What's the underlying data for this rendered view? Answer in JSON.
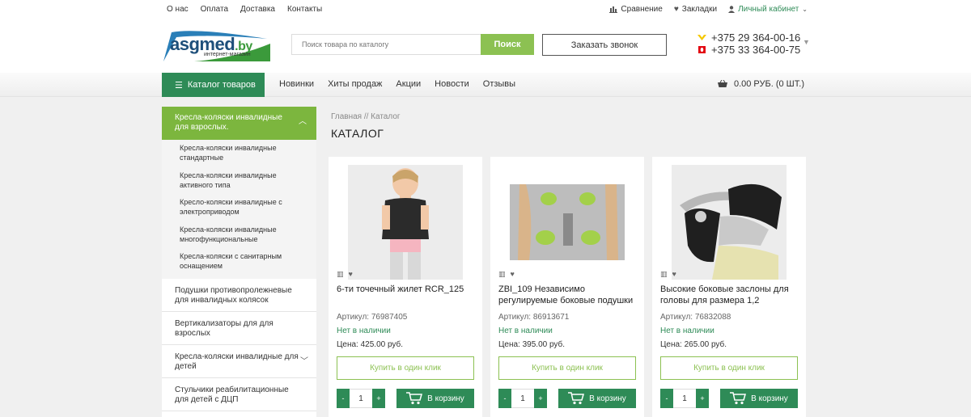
{
  "topbar": {
    "links": [
      "О нас",
      "Оплата",
      "Доставка",
      "Контакты"
    ],
    "compare": "Сравнение",
    "bookmarks": "Закладки",
    "account": "Личный кабинет"
  },
  "logo": {
    "brand": "asgmed",
    "domain": ".by",
    "tagline": "интернет-магазин"
  },
  "search": {
    "placeholder": "Поиск товара по каталогу",
    "button": "Поиск"
  },
  "call_button": "Заказать звонок",
  "phones": [
    "+375 29 364-00-16",
    "+375 33 364-00-75"
  ],
  "nav": {
    "catalog": "Каталог товаров",
    "links": [
      "Новинки",
      "Хиты продаж",
      "Акции",
      "Новости",
      "Отзывы"
    ],
    "cart": "0.00 РУБ. (0 ШТ.)"
  },
  "sidebar": {
    "active": "Кресла-коляски инвалидные для взрослых.",
    "subitems": [
      "Кресла-коляски инвалидные стандартные",
      "Кресла-коляски инвалидные активного типа",
      "Кресло-коляски инвалидные с электроприводом",
      "Кресла-коляски инвалидные многофункциональные",
      "Кресла-коляски с санитарным оснащением"
    ],
    "items": [
      {
        "label": "Подушки противопролежневые для инвалидных колясок",
        "chevron": false
      },
      {
        "label": "Вертикализаторы для для взрослых",
        "chevron": false
      },
      {
        "label": "Кресла-коляски инвалидные для детей",
        "chevron": true
      },
      {
        "label": "Стульчики реабилитационные для детей с ДЦП",
        "chevron": false
      }
    ]
  },
  "breadcrumbs": "Главная  // Каталог",
  "page_title": "КАТАЛОГ",
  "products": [
    {
      "name": "6-ти точечный жилет RCR_125",
      "sku": "Артикул: 76987405",
      "stock": "Нет в наличии",
      "price": "Цена: 425.00 руб."
    },
    {
      "name": "ZBI_109 Независимо регулируемые боковые подушки",
      "sku": "Артикул: 86913671",
      "stock": "Нет в наличии",
      "price": "Цена: 395.00 руб."
    },
    {
      "name": "Высокие боковые заслоны для головы для размера 1,2",
      "sku": "Артикул: 76832088",
      "stock": "Нет в наличии",
      "price": "Цена: 265.00 руб."
    }
  ],
  "card_labels": {
    "one_click": "Купить в один клик",
    "to_cart": "В корзину",
    "qty": "1",
    "minus": "-",
    "plus": "+"
  },
  "colors": {
    "green_dark": "#2e8b57",
    "green_light": "#8cc152",
    "sidebar_active": "#7cb63e"
  }
}
